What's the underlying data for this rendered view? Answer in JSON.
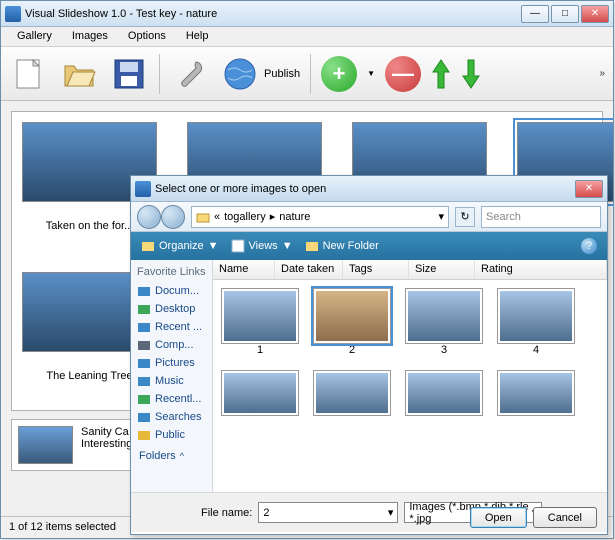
{
  "main": {
    "title": "Visual Slideshow 1.0 - Test key - nature",
    "menu": {
      "gallery": "Gallery",
      "images": "Images",
      "options": "Options",
      "help": "Help"
    },
    "toolbar": {
      "publish": "Publish"
    },
    "thumbs": [
      {
        "caption": "Taken on the for...",
        "selected": false
      },
      {
        "caption": "",
        "selected": false
      },
      {
        "caption": "",
        "selected": false
      },
      {
        "caption": "",
        "selected": true
      }
    ],
    "thumb2_caption": "The Leaning Tree",
    "caption_text": "Sanity Ca\nInteresting",
    "status": "1 of 12 items selected"
  },
  "dialog": {
    "title": "Select one or more images to open",
    "path": {
      "seg1": "togallery",
      "seg2": "nature"
    },
    "search_placeholder": "Search",
    "cmd": {
      "organize": "Organize",
      "views": "Views",
      "newfolder": "New Folder"
    },
    "fav_title": "Favorite Links",
    "fav": [
      {
        "label": "Docum...",
        "color": "#3a88c8"
      },
      {
        "label": "Desktop",
        "color": "#3aa858"
      },
      {
        "label": "Recent ...",
        "color": "#3a88c8"
      },
      {
        "label": "Comp...",
        "color": "#5a6a7a"
      },
      {
        "label": "Pictures",
        "color": "#3a88c8"
      },
      {
        "label": "Music",
        "color": "#3a88c8"
      },
      {
        "label": "Recentl...",
        "color": "#3aa858"
      },
      {
        "label": "Searches",
        "color": "#3a88c8"
      },
      {
        "label": "Public",
        "color": "#e8b838"
      }
    ],
    "folders": "Folders",
    "cols": {
      "name": "Name",
      "date": "Date taken",
      "tags": "Tags",
      "size": "Size",
      "rating": "Rating"
    },
    "files": [
      {
        "label": "1",
        "sel": false
      },
      {
        "label": "2",
        "sel": true
      },
      {
        "label": "3",
        "sel": false
      },
      {
        "label": "4",
        "sel": false
      }
    ],
    "filename_label": "File name:",
    "filename": "2",
    "filter": "Images (*.bmp *.dib *.rle *.jpg",
    "open": "Open",
    "cancel": "Cancel"
  }
}
